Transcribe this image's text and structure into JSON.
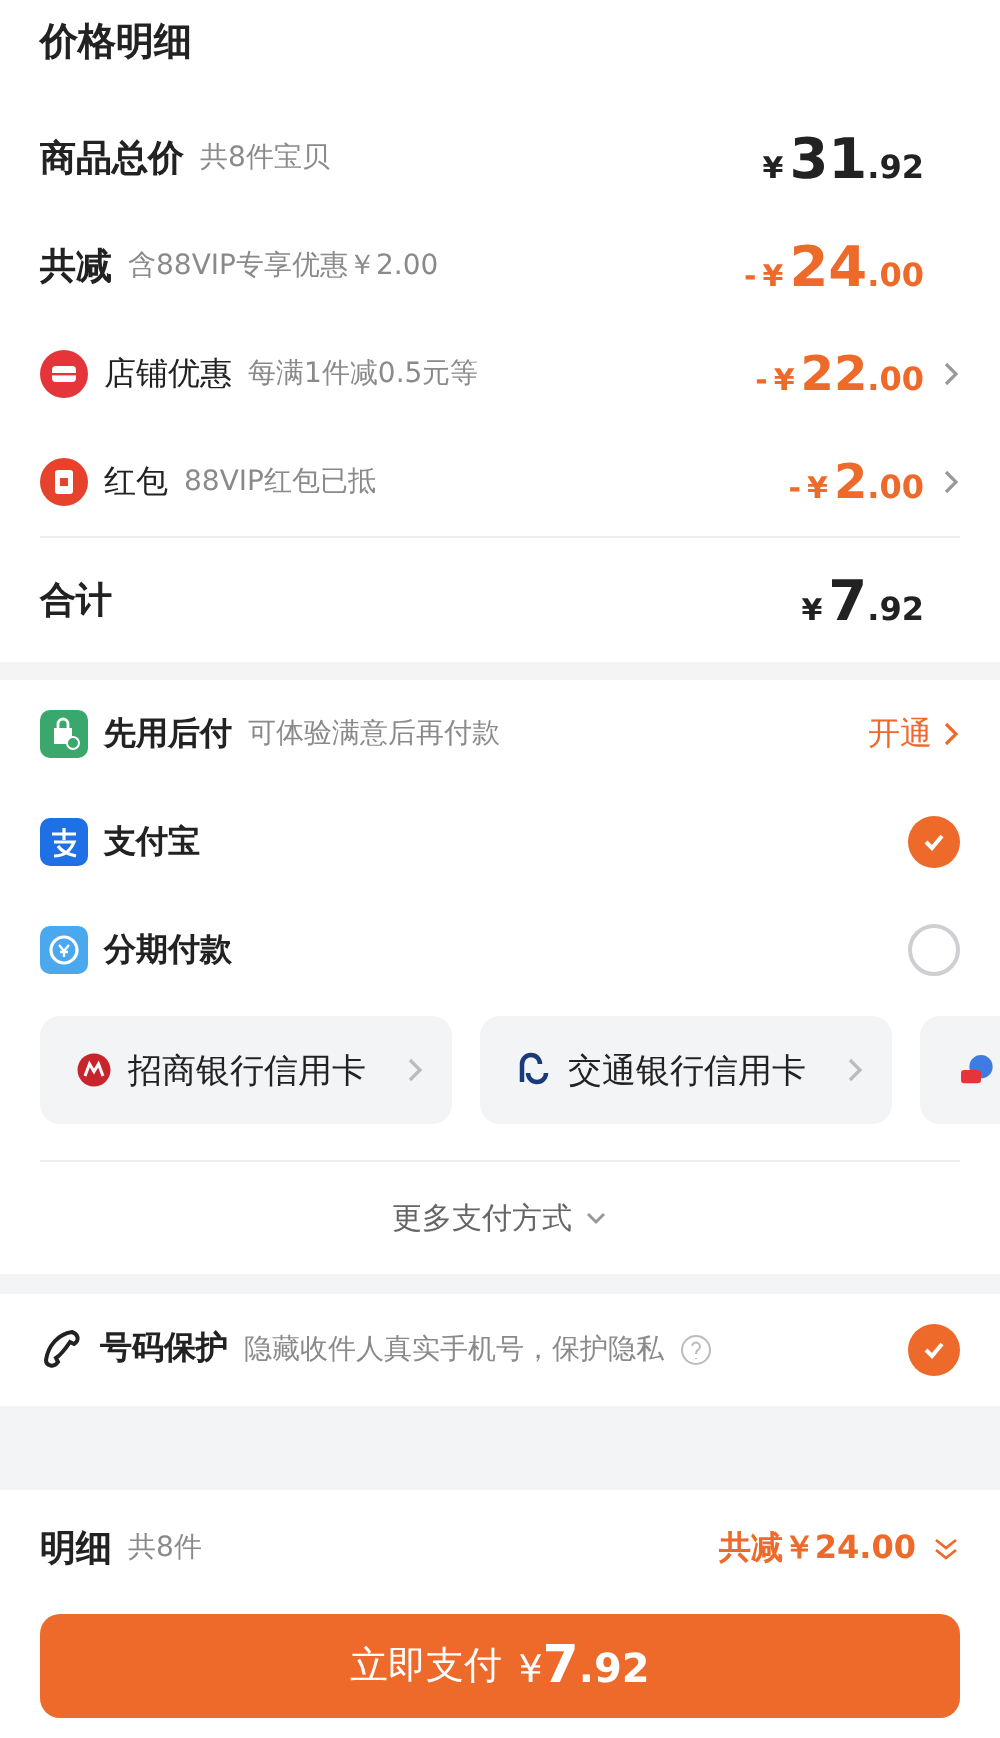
{
  "title": "价格明细",
  "price_rows": [
    {
      "kind": "total",
      "label": "商品总价",
      "note": "共8件宝贝",
      "amount": {
        "currency": "¥",
        "integer": "31",
        "fraction": ".92"
      },
      "chevron": false
    },
    {
      "kind": "discount",
      "label": "共减",
      "note": "含88VIP专享优惠￥2.00",
      "amount": {
        "sign": "-",
        "currency": "¥",
        "integer": "24",
        "fraction": ".00"
      },
      "chevron": false
    },
    {
      "kind": "shop",
      "label": "店铺优惠",
      "note": "每满1件减0.5元等",
      "amount": {
        "sign": "-",
        "currency": "¥",
        "integer": "22",
        "fraction": ".00"
      },
      "chevron": true
    },
    {
      "kind": "redpacket",
      "label": "红包",
      "note": "88VIP红包已抵",
      "amount": {
        "sign": "-",
        "currency": "¥",
        "integer": "2",
        "fraction": ".00"
      },
      "chevron": true
    }
  ],
  "sum": {
    "label": "合计",
    "amount": {
      "currency": "¥",
      "integer": "7",
      "fraction": ".92"
    }
  },
  "payment_methods": [
    {
      "kind": "paylater",
      "label": "先用后付",
      "note": "可体验满意后再付款",
      "action": "开通"
    },
    {
      "kind": "alipay",
      "label": "支付宝",
      "selected": true
    },
    {
      "kind": "installment",
      "label": "分期付款",
      "selected": false
    }
  ],
  "bank_cards": [
    {
      "kind": "cmb",
      "label": "招商银行信用卡"
    },
    {
      "kind": "bocom",
      "label": "交通银行信用卡"
    },
    {
      "kind": "huabei"
    }
  ],
  "more_payment": "更多支付方式",
  "number_protection": {
    "label": "号码保护",
    "note": "隐藏收件人真实手机号，保护隐私",
    "checked": true
  },
  "footer": {
    "label": "明细",
    "count": "共8件",
    "discount": "共减￥24.00",
    "pay_button": {
      "label": "立即支付",
      "currency": "¥",
      "integer": "7",
      "fraction": ".92"
    }
  }
}
